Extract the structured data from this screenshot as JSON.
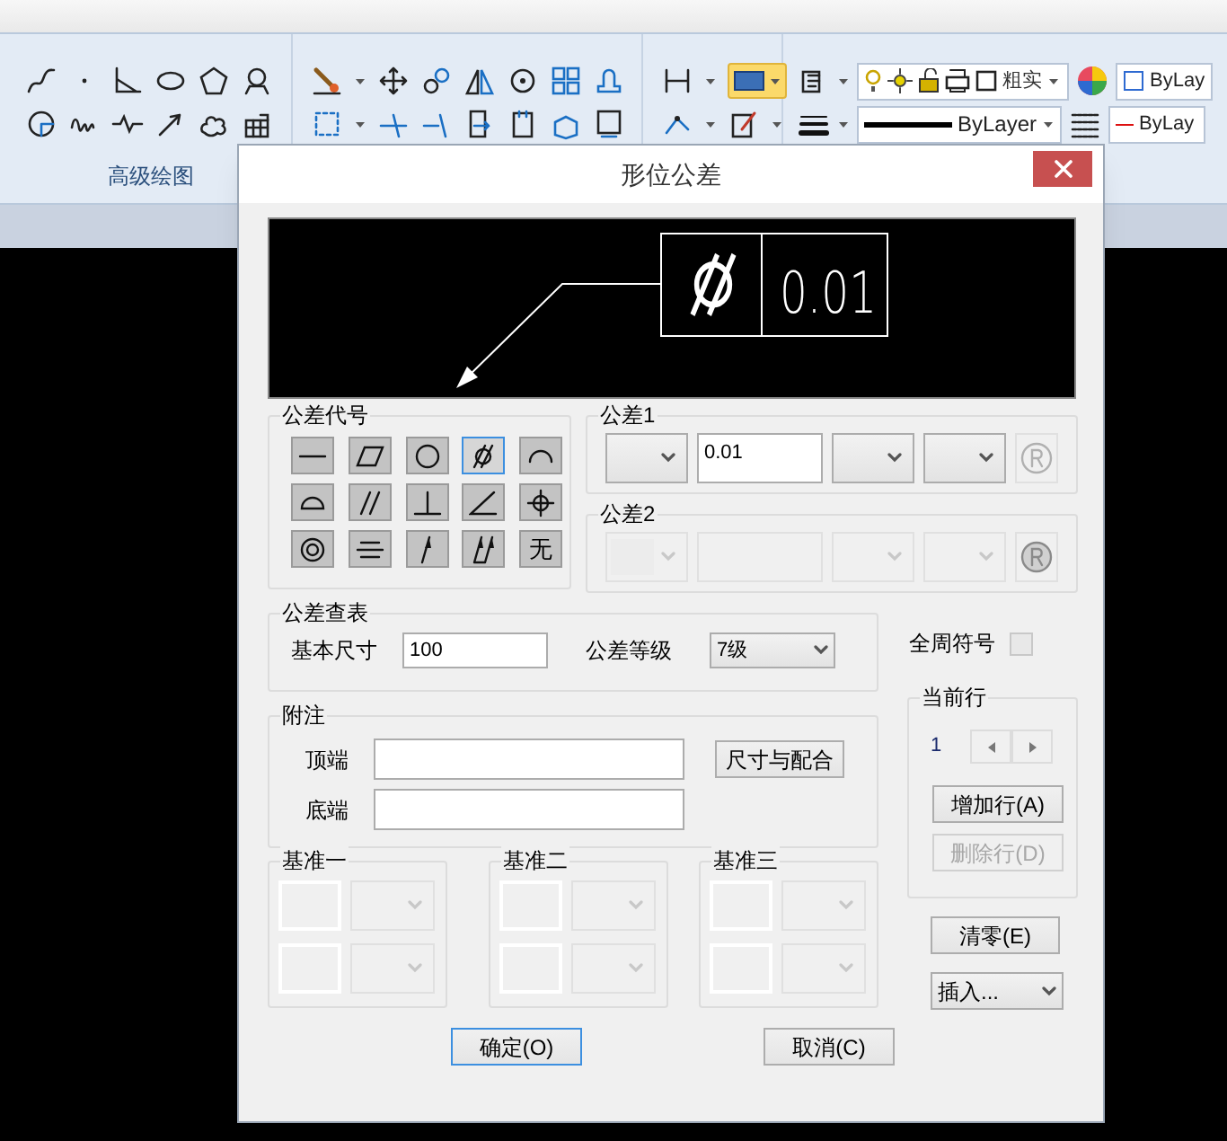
{
  "ribbon": {
    "panel_label": "高级绘图",
    "layer_combo": {
      "value": "粗实"
    },
    "color_combo": {
      "value": "ByLay"
    },
    "linetype_combo": {
      "value": "ByLayer"
    },
    "lineweight_combo": {
      "value": "ByLay"
    }
  },
  "dialog": {
    "title": "形位公差",
    "preview": {
      "value": "0.01"
    },
    "symbols": {
      "label": "公差代号",
      "items": [
        {
          "kind": "straightness",
          "selected": false
        },
        {
          "kind": "flatness",
          "selected": false
        },
        {
          "kind": "circularity",
          "selected": false
        },
        {
          "kind": "cylindricity",
          "selected": true
        },
        {
          "kind": "line_profile",
          "selected": false
        },
        {
          "kind": "surface_profile",
          "selected": false
        },
        {
          "kind": "parallelism",
          "selected": false
        },
        {
          "kind": "perpendicularity",
          "selected": false
        },
        {
          "kind": "angularity",
          "selected": false
        },
        {
          "kind": "position",
          "selected": false
        },
        {
          "kind": "concentricity",
          "selected": false
        },
        {
          "kind": "symmetry",
          "selected": false
        },
        {
          "kind": "circular_runout",
          "selected": false
        },
        {
          "kind": "total_runout",
          "selected": false
        },
        {
          "kind": "text",
          "label": "无",
          "selected": false
        }
      ]
    },
    "tolerances": [
      {
        "label": "公差1",
        "value": "0.01",
        "disabled": false
      },
      {
        "label": "公差2",
        "disabled": true
      }
    ],
    "lookup": {
      "label": "公差查表",
      "basic_size_label": "基本尺寸",
      "basic_size": "100",
      "grade_label": "公差等级",
      "grade": "7级"
    },
    "all_around": {
      "label": "全周符号",
      "checked": false
    },
    "notes": {
      "label": "附注",
      "top_label": "顶端",
      "bottom_label": "底端",
      "fit_button": "尺寸与配合"
    },
    "current_row": {
      "label": "当前行",
      "value": "1",
      "add_button": {
        "label": "增加行(A)",
        "disabled": false
      },
      "delete_button": {
        "label": "删除行(D)",
        "disabled": true
      }
    },
    "datums": [
      {
        "label": "基准一"
      },
      {
        "label": "基准二"
      },
      {
        "label": "基准三"
      }
    ],
    "clear_button": "清零(E)",
    "insert_dropdown": "插入...",
    "ok_button": "确定(O)",
    "cancel_button": "取消(C)"
  }
}
